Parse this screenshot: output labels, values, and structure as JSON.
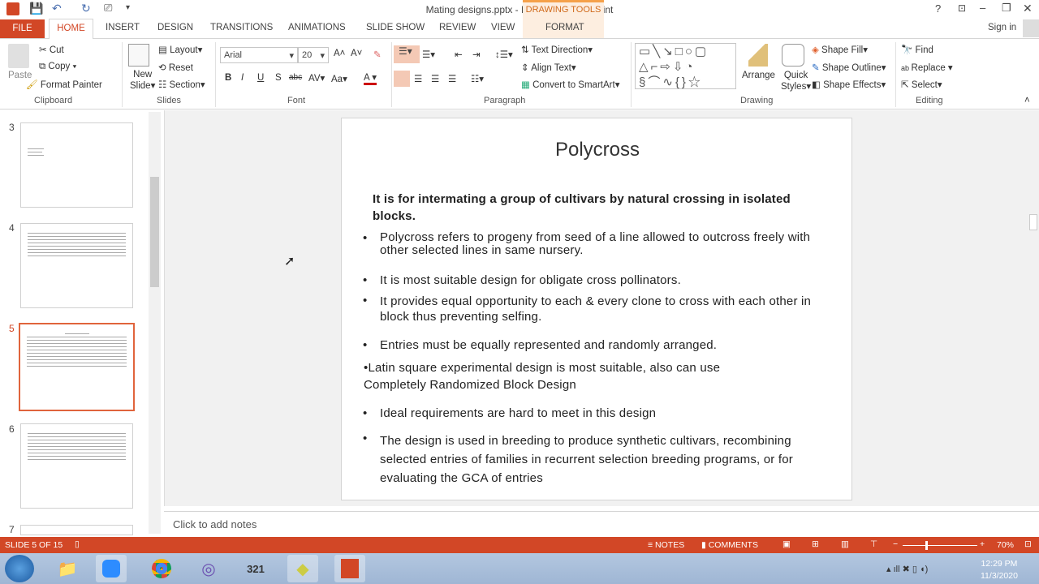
{
  "window": {
    "title": "Mating designs.pptx - Microsoft PowerPoint",
    "contextual_group": "DRAWING TOOLS",
    "sign_in": "Sign in"
  },
  "tabs": [
    "FILE",
    "HOME",
    "INSERT",
    "DESIGN",
    "TRANSITIONS",
    "ANIMATIONS",
    "SLIDE SHOW",
    "REVIEW",
    "VIEW",
    "FORMAT"
  ],
  "ribbon": {
    "clipboard": {
      "paste": "Paste",
      "cut": "Cut",
      "copy": "Copy",
      "format_painter": "Format Painter",
      "label": "Clipboard"
    },
    "slides": {
      "new_slide": "New",
      "new_slide2": "Slide",
      "layout": "Layout",
      "reset": "Reset",
      "section": "Section",
      "label": "Slides"
    },
    "font": {
      "name": "Arial",
      "size": "20",
      "label": "Font"
    },
    "paragraph": {
      "text_direction": "Text Direction",
      "align_text": "Align Text",
      "convert": "Convert to SmartArt",
      "label": "Paragraph"
    },
    "drawing": {
      "arrange": "Arrange",
      "quick": "Quick",
      "styles": "Styles",
      "shape_fill": "Shape Fill",
      "shape_outline": "Shape Outline",
      "shape_effects": "Shape Effects",
      "label": "Drawing"
    },
    "editing": {
      "find": "Find",
      "replace": "Replace",
      "select": "Select",
      "label": "Editing"
    }
  },
  "thumbnails": [
    {
      "num": "3"
    },
    {
      "num": "4"
    },
    {
      "num": "5"
    },
    {
      "num": "6"
    },
    {
      "num": "7"
    }
  ],
  "slide": {
    "title": "Polycross",
    "intro": "It is for intermating a group of cultivars by natural crossing in isolated  blocks.",
    "bullets": [
      "Polycross refers to progeny from seed of a line allowed to outcross freely with other selected lines  in same nursery.",
      "It is most suitable design for obligate cross pollinators.",
      "It provides equal opportunity to each & every clone to cross with each other in block thus preventing selfing.",
      "Entries must be equally represented and randomly arranged."
    ],
    "latin": "•Latin square experimental design is most suitable, also can use Completely Randomized Block Design",
    "bullets2": [
      "Ideal requirements are hard to meet in this design",
      "The design is used in breeding to produce synthetic cultivars, recombining selected entries of families in recurrent selection breeding programs, or for evaluating the GCA of entries"
    ]
  },
  "notes": {
    "placeholder": "Click to add notes"
  },
  "status": {
    "slide": "SLIDE 5 OF 15",
    "notes": "NOTES",
    "comments": "COMMENTS",
    "zoom": "70%"
  },
  "taskbar": {
    "time": "12:29 PM",
    "date": "11/3/2020"
  }
}
